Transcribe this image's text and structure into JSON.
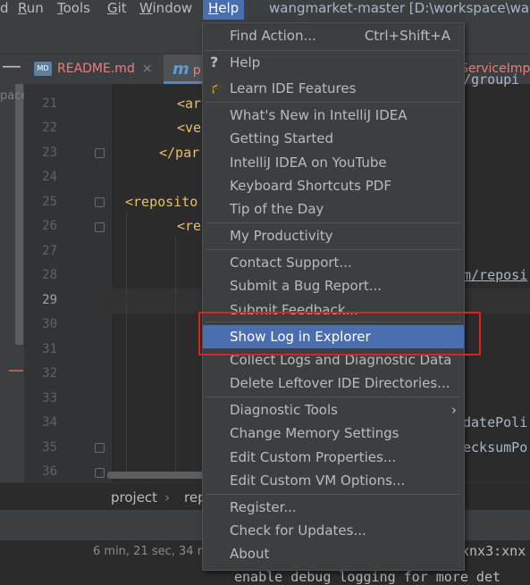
{
  "menubar": {
    "items": [
      {
        "label": "d",
        "id": "d"
      },
      {
        "label": "Run",
        "id": "run"
      },
      {
        "label": "Tools",
        "id": "tools"
      },
      {
        "label": "Git",
        "id": "git"
      },
      {
        "label": "Window",
        "id": "window"
      },
      {
        "label": "Help",
        "id": "help"
      }
    ],
    "window_title": "wangmarket-master [D:\\workspace\\wang"
  },
  "tabs": {
    "readme": {
      "badge": "MD",
      "label": "README.md",
      "close": "×"
    },
    "pom": {
      "icon_letter": "m",
      "label_fragment": "p"
    },
    "service": {
      "label": "ServiceImp"
    }
  },
  "sidebar": {
    "label": "pace\\",
    "collapse": "—"
  },
  "gutter": {
    "line_numbers": [
      "21",
      "22",
      "23",
      "24",
      "25",
      "26",
      "27",
      "28",
      "29",
      "30",
      "31",
      "32",
      "33",
      "34",
      "35",
      "36"
    ],
    "current_line": "29"
  },
  "code": {
    "l21": "<ar",
    "l22": "<ve",
    "l23": "</par",
    "l25": "<reposito",
    "l26": "<re",
    "l28": "m/reposi",
    "l34": "datePoli",
    "l35": "ecksumPo",
    "l20_tail": "/ ,   ,",
    "l20_right": "/groupi"
  },
  "breadcrumbs": {
    "first": "project",
    "separator": "›",
    "second": "rep"
  },
  "status": {
    "time": "6 min, 21 sec, 34 m"
  },
  "console": {
    "line1": "xnx3:xnx",
    "line2": "enable debug logging for more det"
  },
  "help_menu": {
    "find_action": {
      "label": "Find Action...",
      "shortcut": "Ctrl+Shift+A"
    },
    "help": {
      "label": "Help",
      "icon": "question-icon"
    },
    "learn": {
      "label": "Learn IDE Features",
      "icon": "graduation-cap-icon"
    },
    "whats_new": "What's New in IntelliJ IDEA",
    "getting_started": "Getting Started",
    "youtube": "IntelliJ IDEA on YouTube",
    "keyboard_pdf": "Keyboard Shortcuts PDF",
    "tip": "Tip of the Day",
    "productivity": "My Productivity",
    "contact_support": "Contact Support...",
    "bug_report": "Submit a Bug Report...",
    "feedback": "Submit Feedback...",
    "show_log": "Show Log in Explorer",
    "collect_logs": "Collect Logs and Diagnostic Data",
    "delete_dirs": "Delete Leftover IDE Directories...",
    "diagnostic_tools": {
      "label": "Diagnostic Tools",
      "arrow": "›"
    },
    "change_memory": "Change Memory Settings",
    "custom_props": "Edit Custom Properties...",
    "custom_vm": "Edit Custom VM Options...",
    "register": "Register...",
    "updates": "Check for Updates...",
    "about": "About"
  },
  "colors": {
    "menu_bg": "#3c3f41",
    "selection": "#4b6eaf",
    "highlight_box": "#e02020",
    "xml_tag": "#e8bf6a",
    "error_red": "#ea7e7e"
  }
}
